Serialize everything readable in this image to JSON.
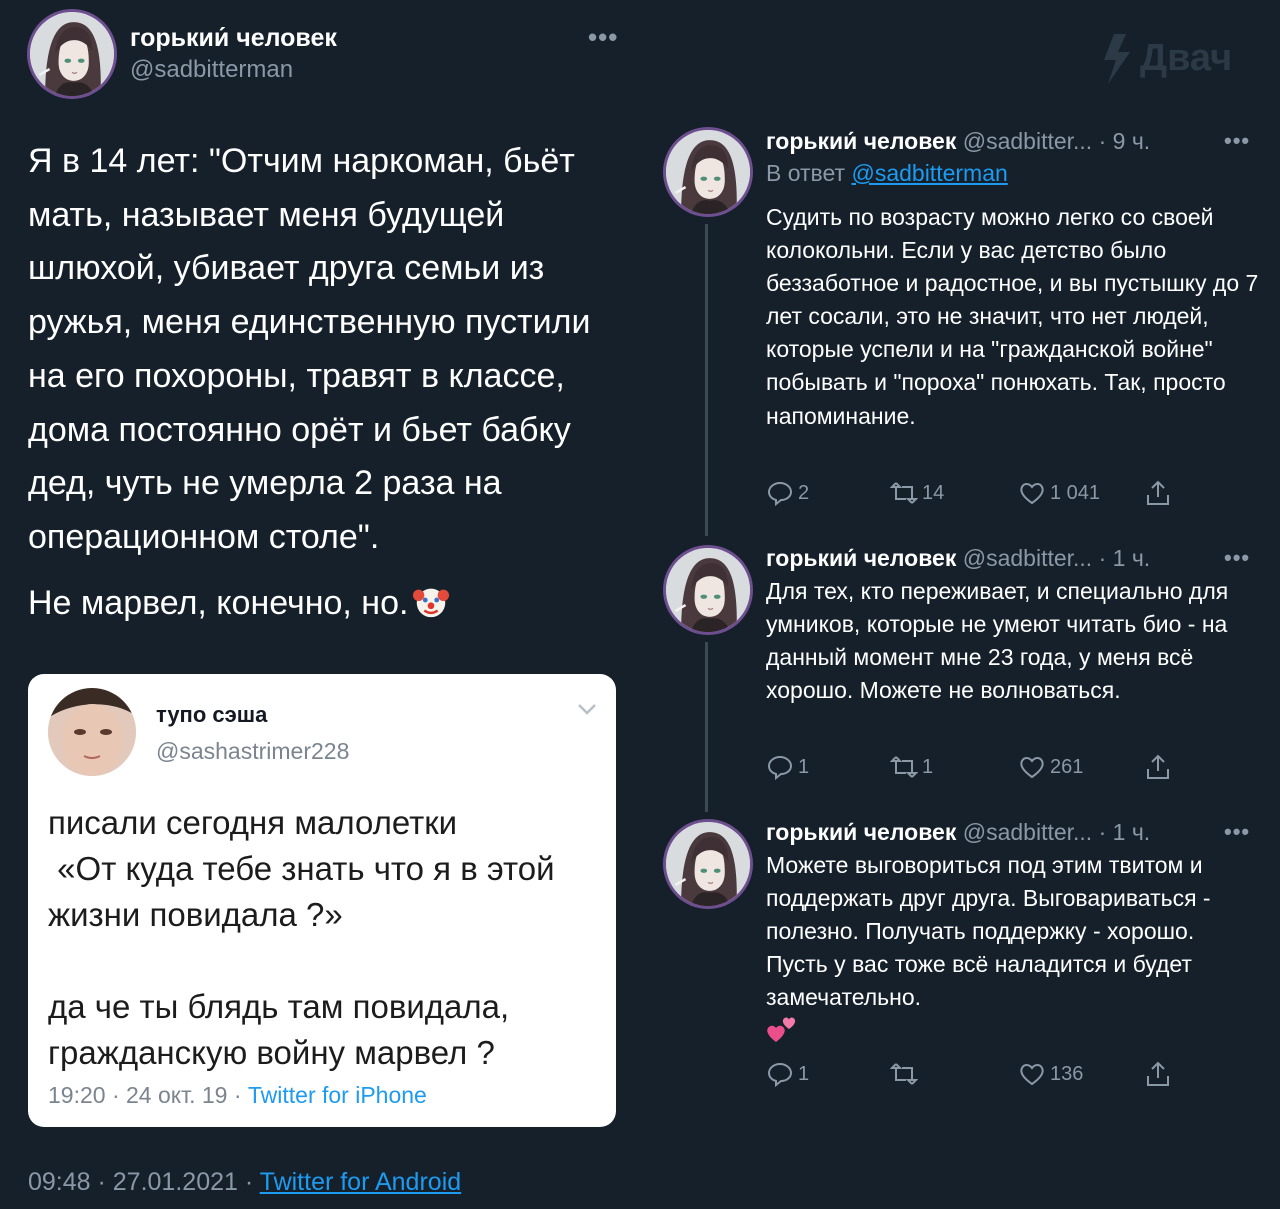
{
  "main_tweet": {
    "name": "горькии́ человек",
    "handle": "@sadbitterman",
    "more_label": "•••",
    "text": "Я в 14 лет: \"Отчим наркоман, бьёт мать, называет меня будущей шлюхой, убивает друга семьи из ружья, меня единственную пустили на его похороны, травят в классе, дома постоянно орёт и бьет бабку дед, чуть не умерла 2 раза на операционном столе\".",
    "text2": "Не марвел, конечно, но.",
    "text2_emoji": "clown-face-emoji",
    "timestamp": "09:48 · 27.01.2021 · ",
    "source": "Twitter for Android"
  },
  "quoted_tweet": {
    "name": "тупо сэша",
    "handle": "@sashastrimer228",
    "text": "писали сегодня малолетки\n «От куда тебе знать что я в этой жизни повидала ?»\n\nда че ты блядь там повидала, гражданскую войну марвел ?",
    "timestamp": "19:20 · 24 окт. 19 · ",
    "source": "Twitter for iPhone"
  },
  "watermark": "Двач",
  "replies": [
    {
      "name": "горькии́ человек",
      "handle": "@sadbitter...",
      "time": "· 9 ч.",
      "more_label": "•••",
      "reply_prefix": "В ответ ",
      "reply_to": "@sadbitterman",
      "text": "Судить по возрасту можно легко со своей колокольни. Если у вас детство было беззаботное и радостное, и вы пустышку до 7 лет сосали, это не значит, что нет людей, которые успели и на \"гражданской войне\" побывать и \"пороха\" понюхать. Так, просто напоминание.",
      "replies_count": "2",
      "retweets_count": "14",
      "likes_count": "1 041"
    },
    {
      "name": "горькии́ человек",
      "handle": "@sadbitter...",
      "time": "· 1 ч.",
      "more_label": "•••",
      "text": "Для тех, кто переживает, и специально для умников, которые не умеют читать био - на данный момент мне 23 года, у меня всё хорошо. Можете не волноваться.",
      "replies_count": "1",
      "retweets_count": "1",
      "likes_count": "261"
    },
    {
      "name": "горькии́ человек",
      "handle": "@sadbitter...",
      "time": "· 1 ч.",
      "more_label": "•••",
      "text": "Можете выговориться под этим твитом и поддержать друг друга. Выговариваться - полезно. Получать поддержку - хорошо. Пусть у вас тоже всё наладится и будет замечательно.",
      "text_emoji": "two-hearts-emoji",
      "replies_count": "1",
      "retweets_count": "",
      "likes_count": "136"
    }
  ],
  "colors": {
    "background": "#15202b",
    "secondary_text": "#8b98a5",
    "link": "#1d9bf0"
  }
}
